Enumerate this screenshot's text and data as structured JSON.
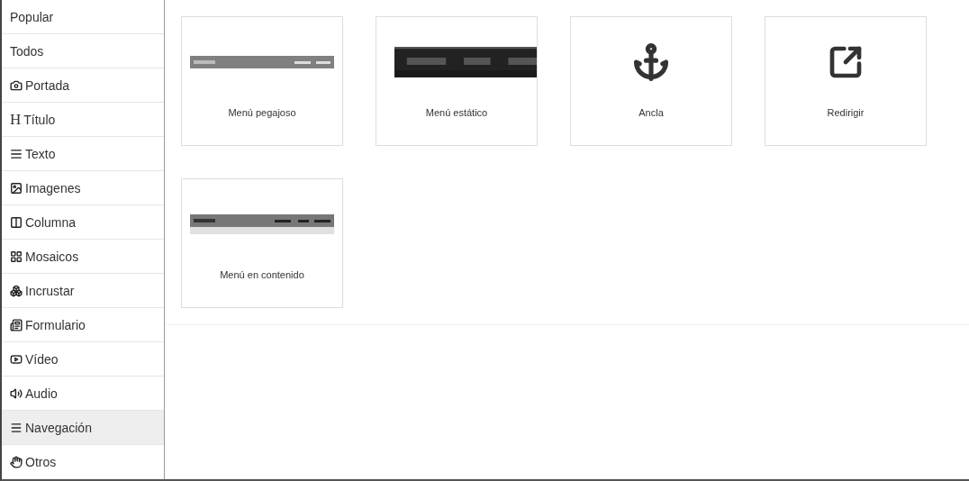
{
  "sidebar": {
    "items": [
      {
        "label": "Popular",
        "selected": false
      },
      {
        "label": "Todos",
        "selected": false
      },
      {
        "label": "Portada",
        "selected": false
      },
      {
        "label": "Título",
        "glyph": "H",
        "selected": false
      },
      {
        "label": "Texto",
        "selected": false
      },
      {
        "label": "Imagenes",
        "selected": false
      },
      {
        "label": "Columna",
        "selected": false
      },
      {
        "label": "Mosaicos",
        "selected": false
      },
      {
        "label": "Incrustar",
        "selected": false
      },
      {
        "label": "Formulario",
        "selected": false
      },
      {
        "label": "Vídeo",
        "selected": false
      },
      {
        "label": "Audio",
        "selected": false
      },
      {
        "label": "Navegación",
        "selected": true
      },
      {
        "label": "Otros",
        "selected": false
      }
    ]
  },
  "cards": [
    {
      "kind": "picture",
      "label": "Menú pegajoso"
    },
    {
      "kind": "picture",
      "label": "Menú estático"
    },
    {
      "kind": "icon",
      "label": "Ancla"
    },
    {
      "kind": "icon",
      "label": "Redirigir"
    },
    {
      "kind": "picture",
      "label": "Menú en contenido"
    }
  ]
}
